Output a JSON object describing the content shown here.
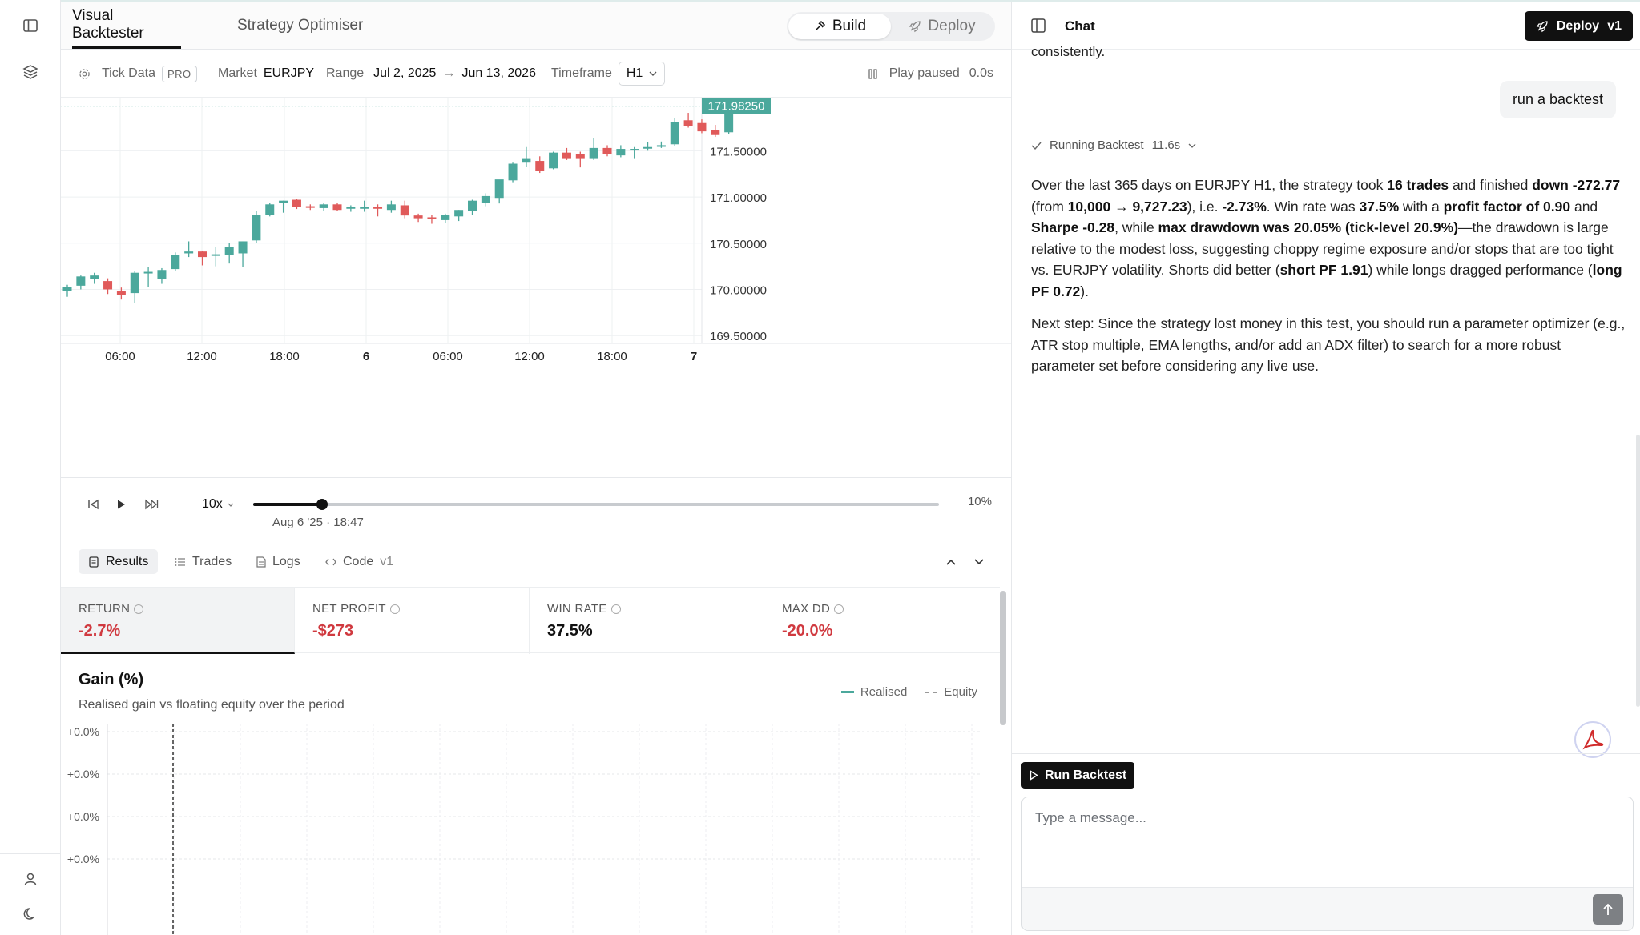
{
  "tabs": {
    "visual": "Visual Backtester",
    "optimiser": "Strategy Optimiser"
  },
  "mode": {
    "build": "Build",
    "deploy": "Deploy"
  },
  "info": {
    "tick_label": "Tick Data",
    "pro": "PRO",
    "market_label": "Market",
    "market": "EURJPY",
    "range_label": "Range",
    "range_from": "Jul 2, 2025",
    "range_arrow": "→",
    "range_to": "Jun 13, 2026",
    "timeframe_label": "Timeframe",
    "timeframe": "H1",
    "play_status": "Play paused",
    "play_time": "0.0s"
  },
  "price_chart": {
    "current_price": "171.98250",
    "y_ticks": [
      "171.50000",
      "171.00000",
      "170.50000",
      "170.00000",
      "169.50000"
    ],
    "x_ticks": [
      "06:00",
      "12:00",
      "18:00",
      "6",
      "06:00",
      "12:00",
      "18:00",
      "7"
    ],
    "colors": {
      "up": "#4ba89c",
      "down": "#e05a5a"
    },
    "candles": [
      {
        "o": 169.98,
        "h": 170.05,
        "l": 169.92,
        "c": 170.03
      },
      {
        "o": 170.04,
        "h": 170.15,
        "l": 170.0,
        "c": 170.14
      },
      {
        "o": 170.11,
        "h": 170.18,
        "l": 170.06,
        "c": 170.15
      },
      {
        "o": 170.09,
        "h": 170.12,
        "l": 169.95,
        "c": 170.0
      },
      {
        "o": 169.98,
        "h": 170.02,
        "l": 169.89,
        "c": 169.94
      },
      {
        "o": 169.96,
        "h": 170.2,
        "l": 169.85,
        "c": 170.18
      },
      {
        "o": 170.18,
        "h": 170.24,
        "l": 170.03,
        "c": 170.19
      },
      {
        "o": 170.11,
        "h": 170.23,
        "l": 170.06,
        "c": 170.21
      },
      {
        "o": 170.22,
        "h": 170.4,
        "l": 170.2,
        "c": 170.37
      },
      {
        "o": 170.39,
        "h": 170.52,
        "l": 170.35,
        "c": 170.41
      },
      {
        "o": 170.41,
        "h": 170.42,
        "l": 170.26,
        "c": 170.35
      },
      {
        "o": 170.37,
        "h": 170.46,
        "l": 170.25,
        "c": 170.38
      },
      {
        "o": 170.37,
        "h": 170.5,
        "l": 170.28,
        "c": 170.46
      },
      {
        "o": 170.39,
        "h": 170.52,
        "l": 170.24,
        "c": 170.52
      },
      {
        "o": 170.53,
        "h": 170.85,
        "l": 170.5,
        "c": 170.81
      },
      {
        "o": 170.81,
        "h": 170.94,
        "l": 170.79,
        "c": 170.92
      },
      {
        "o": 170.94,
        "h": 170.96,
        "l": 170.83,
        "c": 170.96
      },
      {
        "o": 170.97,
        "h": 170.98,
        "l": 170.87,
        "c": 170.89
      },
      {
        "o": 170.9,
        "h": 170.92,
        "l": 170.86,
        "c": 170.89
      },
      {
        "o": 170.88,
        "h": 170.94,
        "l": 170.85,
        "c": 170.92
      },
      {
        "o": 170.92,
        "h": 170.94,
        "l": 170.85,
        "c": 170.86
      },
      {
        "o": 170.88,
        "h": 170.91,
        "l": 170.84,
        "c": 170.89
      },
      {
        "o": 170.89,
        "h": 170.96,
        "l": 170.84,
        "c": 170.89
      },
      {
        "o": 170.89,
        "h": 170.92,
        "l": 170.79,
        "c": 170.88
      },
      {
        "o": 170.86,
        "h": 170.96,
        "l": 170.83,
        "c": 170.92
      },
      {
        "o": 170.91,
        "h": 170.96,
        "l": 170.77,
        "c": 170.8
      },
      {
        "o": 170.8,
        "h": 170.82,
        "l": 170.73,
        "c": 170.77
      },
      {
        "o": 170.78,
        "h": 170.81,
        "l": 170.71,
        "c": 170.76
      },
      {
        "o": 170.75,
        "h": 170.82,
        "l": 170.72,
        "c": 170.81
      },
      {
        "o": 170.79,
        "h": 170.86,
        "l": 170.74,
        "c": 170.86
      },
      {
        "o": 170.85,
        "h": 170.97,
        "l": 170.81,
        "c": 170.96
      },
      {
        "o": 170.94,
        "h": 171.04,
        "l": 170.9,
        "c": 171.01
      },
      {
        "o": 170.99,
        "h": 171.08,
        "l": 170.93,
        "c": 171.19
      },
      {
        "o": 171.18,
        "h": 171.38,
        "l": 171.16,
        "c": 171.36
      },
      {
        "o": 171.38,
        "h": 171.54,
        "l": 171.33,
        "c": 171.42
      },
      {
        "o": 171.39,
        "h": 171.44,
        "l": 171.26,
        "c": 171.28
      },
      {
        "o": 171.31,
        "h": 171.49,
        "l": 171.3,
        "c": 171.48
      },
      {
        "o": 171.48,
        "h": 171.53,
        "l": 171.4,
        "c": 171.42
      },
      {
        "o": 171.46,
        "h": 171.49,
        "l": 171.32,
        "c": 171.42
      },
      {
        "o": 171.42,
        "h": 171.64,
        "l": 171.4,
        "c": 171.53
      },
      {
        "o": 171.53,
        "h": 171.56,
        "l": 171.44,
        "c": 171.46
      },
      {
        "o": 171.45,
        "h": 171.56,
        "l": 171.43,
        "c": 171.52
      },
      {
        "o": 171.51,
        "h": 171.54,
        "l": 171.42,
        "c": 171.52
      },
      {
        "o": 171.53,
        "h": 171.59,
        "l": 171.5,
        "c": 171.54
      },
      {
        "o": 171.55,
        "h": 171.6,
        "l": 171.53,
        "c": 171.56
      },
      {
        "o": 171.57,
        "h": 171.85,
        "l": 171.55,
        "c": 171.81
      },
      {
        "o": 171.83,
        "h": 171.91,
        "l": 171.75,
        "c": 171.77
      },
      {
        "o": 171.8,
        "h": 171.84,
        "l": 171.69,
        "c": 171.71
      },
      {
        "o": 171.72,
        "h": 171.78,
        "l": 171.65,
        "c": 171.67
      },
      {
        "o": 171.7,
        "h": 171.98,
        "l": 171.68,
        "c": 171.98
      }
    ]
  },
  "playback": {
    "speed": "10x",
    "date": "Aug 6 '25 · 18:47",
    "progress": 10,
    "progress_label": "10%"
  },
  "results_tabs": {
    "results": "Results",
    "trades": "Trades",
    "logs": "Logs",
    "code": "Code",
    "code_version": "v1"
  },
  "metrics": [
    {
      "label": "RETURN",
      "value": "-2.7%",
      "tone": "neg"
    },
    {
      "label": "NET PROFIT",
      "value": "-$273",
      "tone": "neg"
    },
    {
      "label": "WIN RATE",
      "value": "37.5%",
      "tone": "pos"
    },
    {
      "label": "MAX DD",
      "value": "-20.0%",
      "tone": "neg"
    }
  ],
  "gain": {
    "title": "Gain (%)",
    "subtitle": "Realised gain vs floating equity over the period",
    "legend_realised": "Realised",
    "legend_equity": "Equity",
    "y_ticks": [
      "+0.0%",
      "+0.0%",
      "+0.0%",
      "+0.0%"
    ]
  },
  "chat": {
    "title": "Chat",
    "deploy": "Deploy",
    "deploy_version": "v1",
    "cut_text": "consistently.",
    "user_message": "run a backtest",
    "status": "Running Backtest",
    "status_time": "11.6s",
    "p1": [
      "Over the last 365 days on EURJPY H1, the strategy took ",
      {
        "b": "16 trades"
      },
      " and finished ",
      {
        "b": "down -272.77"
      },
      " (from ",
      {
        "b": "10,000 → 9,727.23"
      },
      "), i.e. ",
      {
        "b": "-2.73%"
      },
      ". Win rate was ",
      {
        "b": "37.5%"
      },
      " with a ",
      {
        "b": "profit factor of 0.90"
      },
      " and ",
      {
        "b": "Sharpe -0.28"
      },
      ", while ",
      {
        "b": "max drawdown was 20.05% (tick-level 20.9%)"
      },
      "—the drawdown is large relative to the modest loss, suggesting choppy regime exposure and/or stops that are too tight vs. EURJPY volatility. Shorts did better (",
      {
        "b": "short PF 1.91"
      },
      ") while longs dragged performance (",
      {
        "b": "long PF 0.72"
      },
      ")."
    ],
    "p2": "Next step: Since the strategy lost money in this test, you should run a parameter optimizer (e.g., ATR stop multiple, EMA lengths, and/or add an ADX filter) to search for a more robust parameter set before considering any live use.",
    "run_button": "Run Backtest",
    "placeholder": "Type a message..."
  }
}
